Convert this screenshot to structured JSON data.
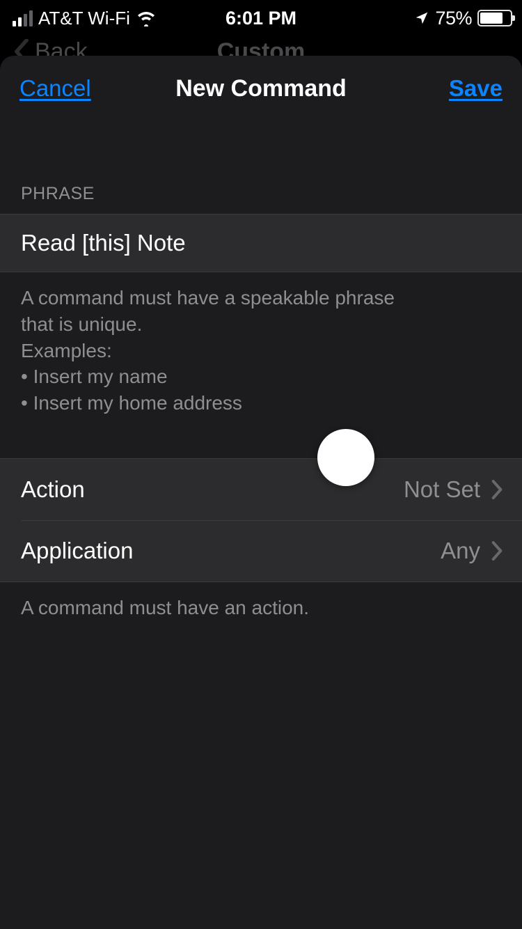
{
  "status_bar": {
    "carrier": "AT&T Wi-Fi",
    "time": "6:01 PM",
    "battery_percent": "75%"
  },
  "background_nav": {
    "back_label": "Back",
    "title": "Custom"
  },
  "modal": {
    "cancel_label": "Cancel",
    "title": "New Command",
    "save_label": "Save"
  },
  "phrase_section": {
    "header": "PHRASE",
    "input_value": "Read [this] Note",
    "footer": "A command must have a speakable phrase that is unique.\nExamples:\n• Insert my name\n• Insert my home address"
  },
  "settings": {
    "action": {
      "label": "Action",
      "value": "Not Set"
    },
    "application": {
      "label": "Application",
      "value": "Any"
    },
    "footer": "A command must have an action."
  }
}
